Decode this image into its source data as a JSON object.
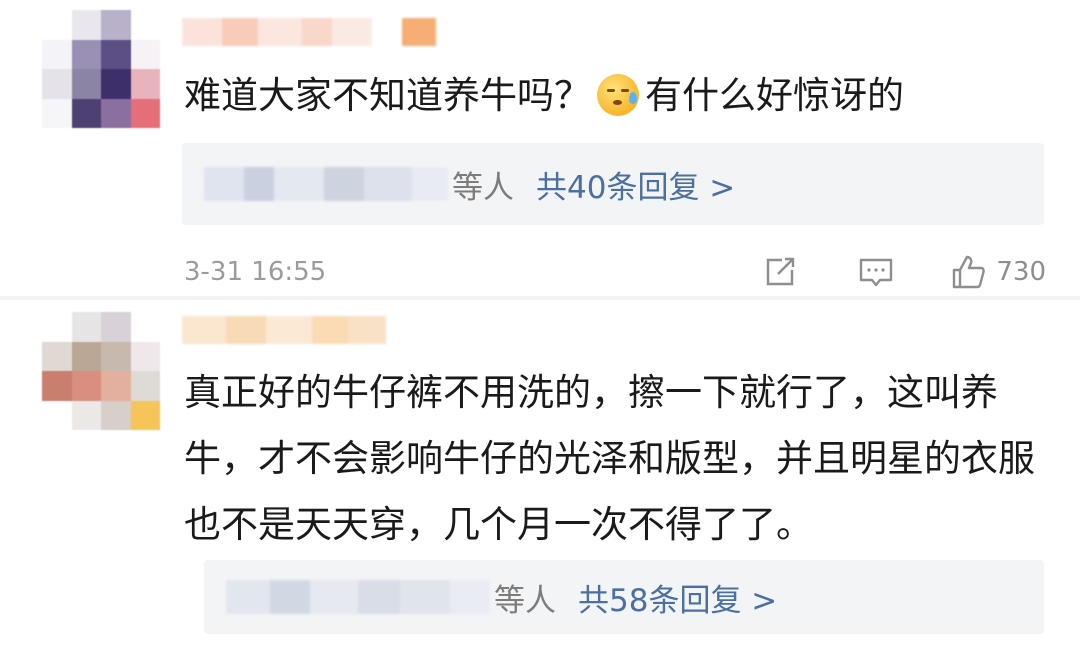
{
  "comments": [
    {
      "text": "难道大家不知道养牛吗？",
      "text_after_emoji": "有什么好惊讶的",
      "emoji": "sweat-emoji",
      "replies": {
        "suffix": "等人",
        "count_label": "共40条回复 >"
      },
      "time": "3-31 16:55",
      "likes": "730"
    },
    {
      "text": "真正好的牛仔裤不用洗的，擦一下就行了，这叫养牛，才不会影响牛仔的光泽和版型，并且明星的衣服也不是天天穿，几个月一次不得了了。",
      "replies": {
        "suffix": "等人",
        "count_label": "共58条回复 >"
      }
    }
  ],
  "colors": {
    "link": "#4a6fa0",
    "text": "#1a1a1a",
    "muted": "#9b9b9b",
    "reply_bg": "#f3f4f6"
  },
  "icons": [
    "share-icon",
    "comment-icon",
    "like-icon"
  ]
}
